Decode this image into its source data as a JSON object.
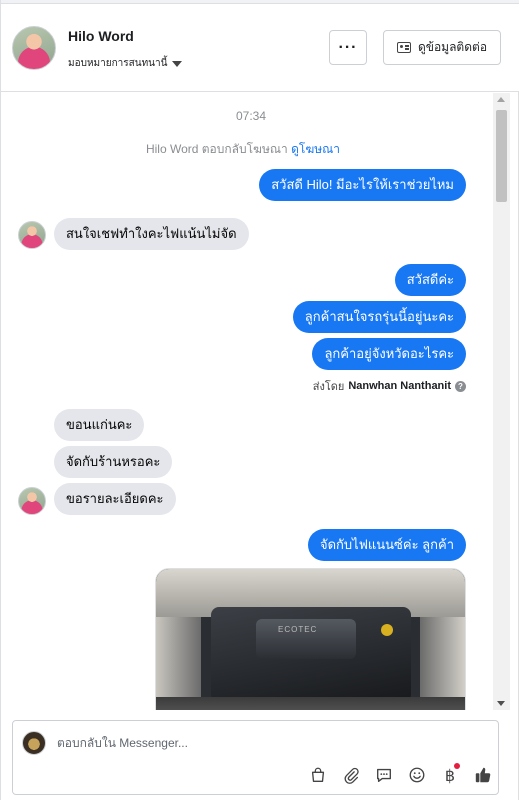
{
  "header": {
    "name": "Hilo Word",
    "assign_label": "มอบหมายการสนทนานี้",
    "more_label": "···",
    "contact_label": "ดูข้อมูลติดต่อ"
  },
  "conversation": {
    "timestamp": "07:34",
    "notice_prefix": "Hilo Word ตอบกลับโฆษณา ",
    "notice_link": "ดูโฆษณา",
    "messages": [
      {
        "dir": "out",
        "text": "สวัสดี Hilo! มีอะไรให้เราช่วยไหม"
      },
      {
        "dir": "in",
        "text": "สนใจเชฟทำใงคะไฟแน้นไม่จัด"
      },
      {
        "dir": "out",
        "text": "สวัสดีค่ะ"
      },
      {
        "dir": "out",
        "text": "ลูกค้าสนใจรถรุ่นนี้อยู่นะคะ"
      },
      {
        "dir": "out",
        "text": "ลูกค้าอยู่จังหวัดอะไรคะ"
      },
      {
        "dir": "in",
        "text": "ขอนแก่นคะ"
      },
      {
        "dir": "in",
        "text": "จัดกับร้านหรอคะ"
      },
      {
        "dir": "in",
        "text": "ขอรายละเอียดคะ"
      },
      {
        "dir": "out",
        "text": "จัดกับไฟแนนซ์ค่ะ ลูกค้า"
      }
    ],
    "sent_by_prefix": "ส่งโดย",
    "sent_by_name": "Nanwhan Nanthanit",
    "photo_text": "ECOTEC"
  },
  "composer": {
    "placeholder": "ตอบกลับใน Messenger...",
    "tools": [
      "bag-icon",
      "attachment-icon",
      "chat-icon",
      "emoji-icon",
      "baht-icon",
      "thumbs-up-icon"
    ]
  },
  "colors": {
    "accent": "#1877f2",
    "incoming_bubble": "#e4e6eb",
    "notification_dot": "#e41e3f"
  }
}
